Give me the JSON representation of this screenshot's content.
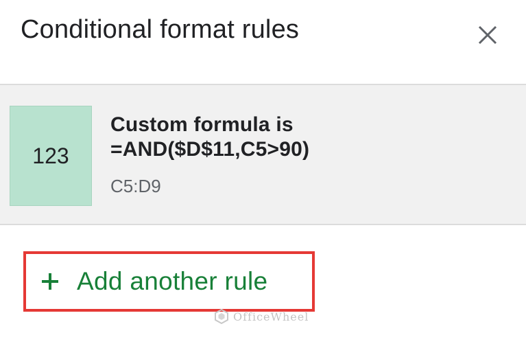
{
  "panel": {
    "title": "Conditional format rules"
  },
  "rule": {
    "preview_text": "123",
    "preview_color": "#b8e2cf",
    "condition": "Custom formula is",
    "formula": "=AND($D$11,C5>90)",
    "range": "C5:D9"
  },
  "actions": {
    "add_rule_label": "Add another rule",
    "accent_color": "#188038",
    "highlight_color": "#e53935"
  },
  "watermark": {
    "text": "OfficeWheel"
  },
  "icons": {
    "close": "close-icon",
    "add": "plus-icon",
    "watermark_logo": "officewheel-logo-icon"
  }
}
